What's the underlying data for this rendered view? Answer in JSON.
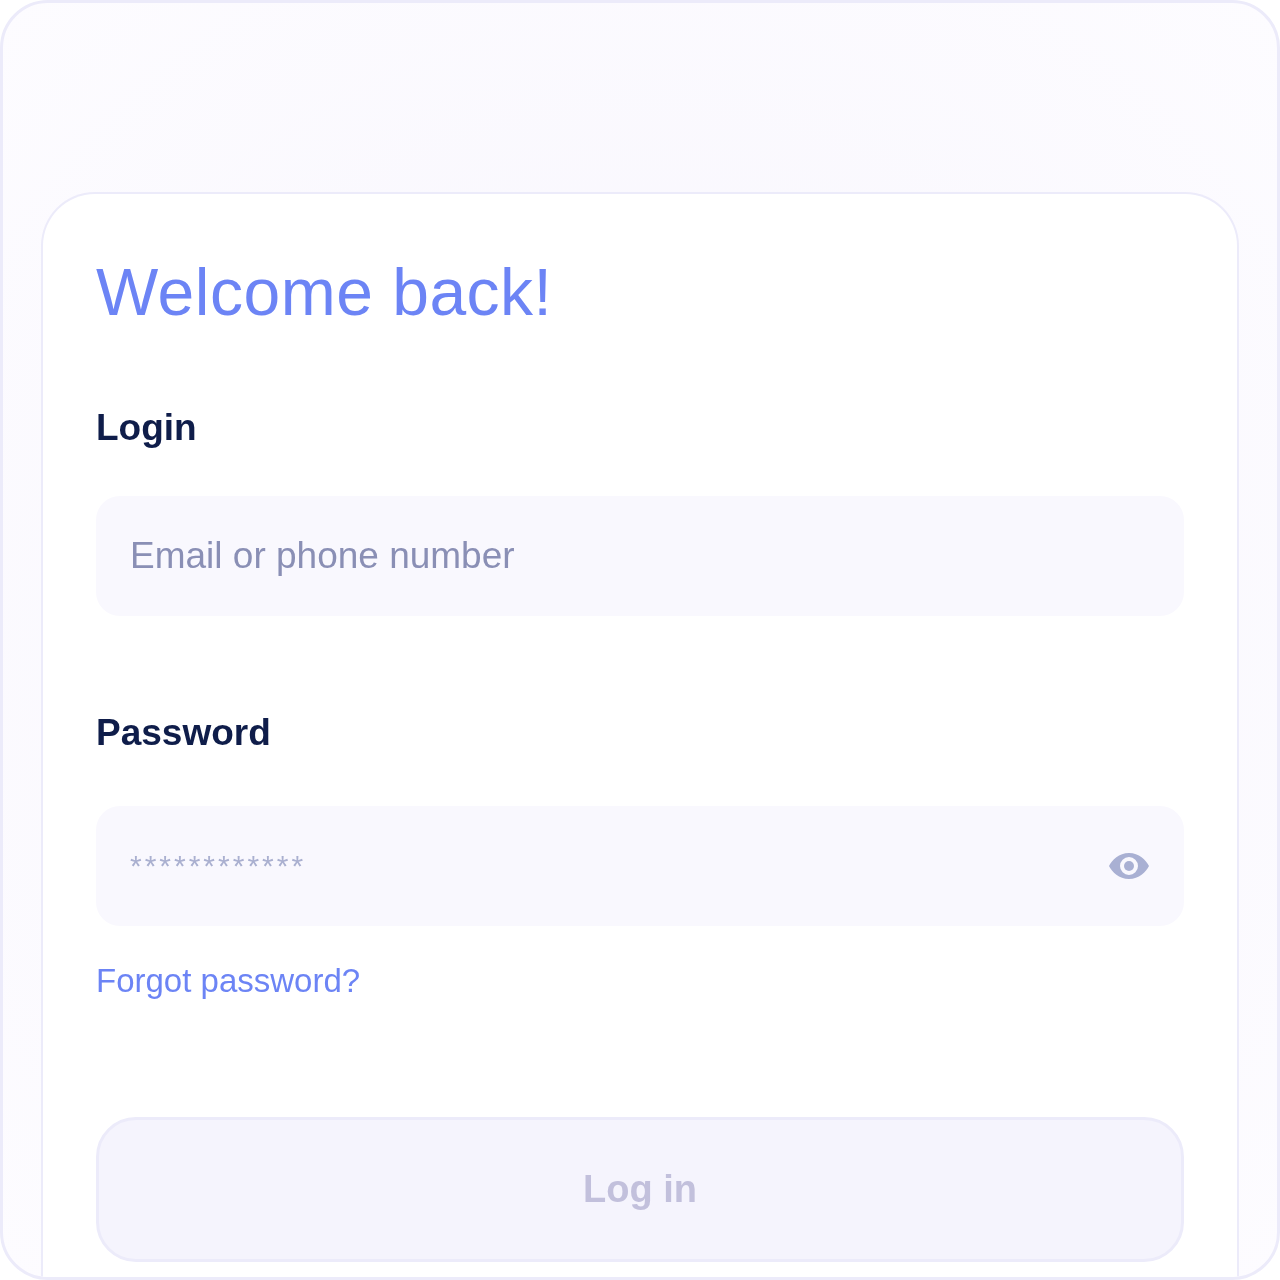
{
  "title": "Welcome back!",
  "login": {
    "label": "Login",
    "placeholder": "Email or phone number"
  },
  "password": {
    "label": "Password",
    "placeholder": "************"
  },
  "forgot_link": "Forgot password?",
  "submit": {
    "label": "Log in",
    "disabled": true
  }
}
